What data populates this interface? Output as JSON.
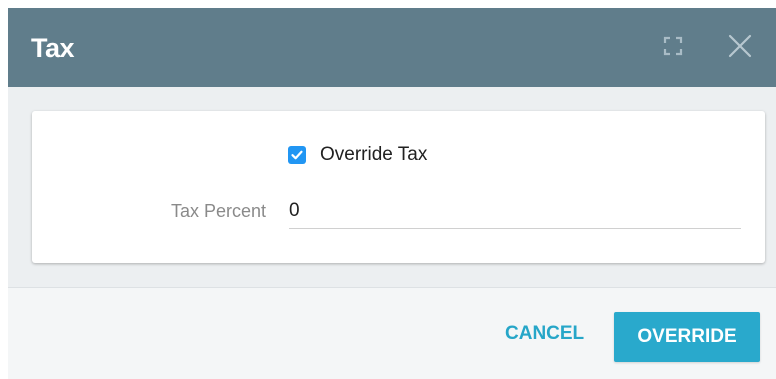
{
  "dialog": {
    "title": "Tax",
    "header_color": "#607d8b",
    "icons": {
      "expand": "fullscreen-icon",
      "close": "close-icon"
    }
  },
  "form": {
    "override_checkbox": {
      "label": "Override Tax",
      "checked": true,
      "color": "#2196f3"
    },
    "tax_percent": {
      "label": "Tax Percent",
      "value": "0"
    }
  },
  "footer": {
    "cancel_label": "CANCEL",
    "override_label": "OVERRIDE",
    "accent_color": "#29a9cc"
  }
}
